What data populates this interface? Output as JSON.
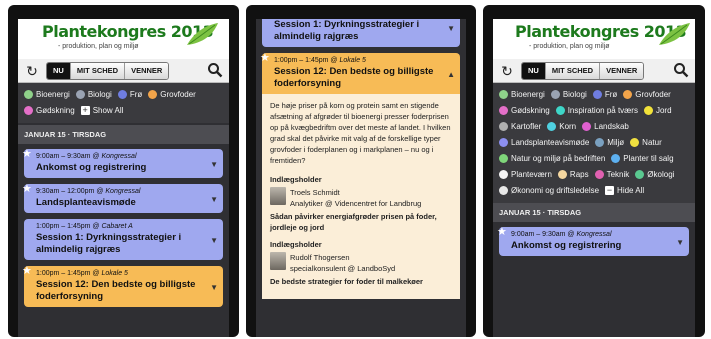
{
  "app": {
    "logo_title": "Plantekongres 2013",
    "logo_subtitle": "- produktion, plan og miljø",
    "accent": "#1d7a1d"
  },
  "nav": {
    "tabs": [
      "NU",
      "MIT SCHED",
      "VENNER"
    ],
    "active_tab": "NU",
    "refresh_icon": "refresh-icon",
    "search_icon": "search-icon"
  },
  "day_header": "JANUAR 15 · TIRSDAG",
  "screen1": {
    "filters": [
      {
        "label": "Bioenergi",
        "color": "#8fd18a"
      },
      {
        "label": "Biologi",
        "color": "#9aa3b3"
      },
      {
        "label": "Frø",
        "color": "#6f7de0"
      },
      {
        "label": "Grovfoder",
        "color": "#f2a44a"
      },
      {
        "label": "Gødskning",
        "color": "#e46fc8"
      }
    ],
    "show_all": "Show All",
    "events": [
      {
        "time": "9:00am – 9:30am @",
        "place": "Kongressal",
        "title": "Ankomst og registrering",
        "color": "blue",
        "starred": true
      },
      {
        "time": "9:30am – 12:00pm @",
        "place": "Kongressal",
        "title": "Landsplanteavismøde",
        "color": "blue",
        "starred": true
      },
      {
        "time": "1:00pm – 1:45pm @",
        "place": "Cabaret A",
        "title": "Session 1: Dyrkningsstrategier i almindelig rajgræs",
        "color": "blue",
        "starred": false
      },
      {
        "time": "1:00pm – 1:45pm @",
        "place": "Lokale 5",
        "title": "Session 12: Den bedste og billigste foderforsyning",
        "color": "orange",
        "starred": true
      }
    ]
  },
  "screen2": {
    "top_event_title": "Session 1: Dyrkningsstrategier i almindelig rajgræs",
    "event": {
      "time": "1:00pm – 1:45pm @",
      "place": "Lokale 5",
      "title": "Session 12: Den bedste og billigste foderforsyning"
    },
    "description": "De høje priser på korn og protein samt en stigende afsætning af afgrøder til bioenergi presser foderprisen op på kvægbedriftm over det meste af landet. I hvilken grad skal det påvirke mit valg af de forskellige typer grovfoder i foderplanen og i markplanen – nu og i fremtiden?",
    "speakers": [
      {
        "label": "Indlægsholder",
        "name": "Troels Schmidt",
        "role": "Analytiker @ Videncentret for Landbrug",
        "talk": "Sådan påvirker energiafgrøder prisen på foder, jordleje og jord"
      },
      {
        "label": "Indlægsholder",
        "name": "Rudolf Thogersen",
        "role": "specialkonsulent @ LandboSyd",
        "talk": "De bedste strategier for foder til malkekøer"
      }
    ]
  },
  "screen3": {
    "filters": [
      {
        "label": "Bioenergi",
        "color": "#8fd18a"
      },
      {
        "label": "Biologi",
        "color": "#9aa3b3"
      },
      {
        "label": "Frø",
        "color": "#6f7de0"
      },
      {
        "label": "Grovfoder",
        "color": "#f2a44a"
      },
      {
        "label": "Gødskning",
        "color": "#e46fc8"
      },
      {
        "label": "Inspiration på tværs",
        "color": "#3ed6c8"
      },
      {
        "label": "Jord",
        "color": "#f2e23a"
      },
      {
        "label": "Kartofler",
        "color": "#b0b0b0"
      },
      {
        "label": "Korn",
        "color": "#4fd0e0"
      },
      {
        "label": "Landskab",
        "color": "#e060d0"
      },
      {
        "label": "Landsplanteavismøde",
        "color": "#8c8ff0"
      },
      {
        "label": "Miljø",
        "color": "#7aa0c0"
      },
      {
        "label": "Natur",
        "color": "#f0e040"
      },
      {
        "label": "Natur og miljø på bedriften",
        "color": "#7fd67a"
      },
      {
        "label": "Planter til salg",
        "color": "#5db0f0"
      },
      {
        "label": "Planteværn",
        "color": "#f4f4f4"
      },
      {
        "label": "Raps",
        "color": "#f5d7a0"
      },
      {
        "label": "Teknik",
        "color": "#e060b0"
      },
      {
        "label": "Økologi",
        "color": "#5ac890"
      },
      {
        "label": "Økonomi og driftsledelse",
        "color": "#e8e8e8"
      }
    ],
    "hide_all": "Hide All",
    "events": [
      {
        "time": "9:00am – 9:30am @",
        "place": "Kongressal",
        "title": "Ankomst og registrering",
        "color": "blue",
        "starred": true
      }
    ]
  }
}
